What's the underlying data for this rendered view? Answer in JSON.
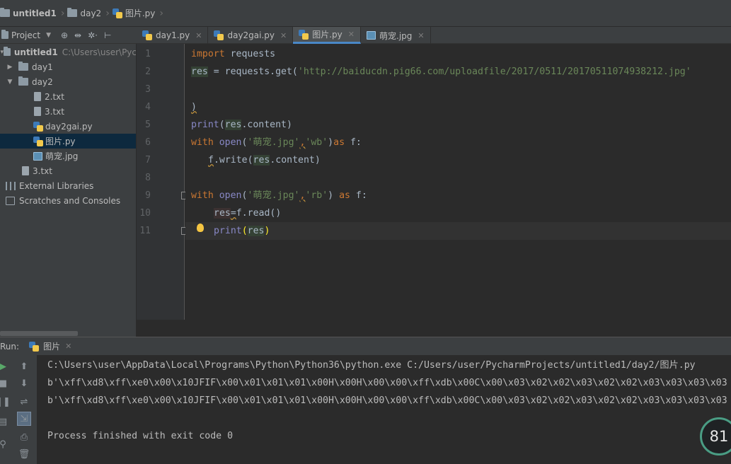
{
  "breadcrumb": {
    "project": "untitled1",
    "folder": "day2",
    "file": "图片.py"
  },
  "project_panel": {
    "title": "Project",
    "tools": [
      "⊕",
      "⇹",
      "✲·",
      "⊢"
    ]
  },
  "tabs": [
    {
      "label": "day1.py",
      "icon": "python-file-icon"
    },
    {
      "label": "day2gai.py",
      "icon": "python-file-icon"
    },
    {
      "label": "图片.py",
      "icon": "python-file-icon",
      "active": true
    },
    {
      "label": "萌宠.jpg",
      "icon": "image-file-icon"
    }
  ],
  "tree": {
    "root": {
      "label": "untitled1",
      "path": "C:\\Users\\user\\Pyc"
    },
    "items": [
      {
        "label": "day1",
        "type": "folder"
      },
      {
        "label": "day2",
        "type": "folder"
      },
      {
        "label": "2.txt",
        "type": "text"
      },
      {
        "label": "3.txt",
        "type": "text"
      },
      {
        "label": "day2gai.py",
        "type": "python"
      },
      {
        "label": "图片.py",
        "type": "python",
        "selected": true
      },
      {
        "label": "萌宠.jpg",
        "type": "image"
      },
      {
        "label": "3.txt",
        "type": "text"
      },
      {
        "label": "External Libraries",
        "type": "libraries"
      },
      {
        "label": "Scratches and Consoles",
        "type": "scratches"
      }
    ]
  },
  "editor": {
    "line_numbers": [
      "1",
      "2",
      "3",
      "4",
      "5",
      "6",
      "7",
      "8",
      "9",
      "10",
      "11"
    ],
    "lines": {
      "l1_kw": "import",
      "l1_rest": " requests",
      "l2_a": "res",
      "l2_b": " = requests.get(",
      "l2_str": "'http://baiducdn.pig66.com/uploadfile/2017/0511/20170511074938212.jpg'",
      "l4": ")",
      "l5_fn": "print",
      "l5_a": "(",
      "l5_res": "res",
      "l5_b": ".content)",
      "l6_kw": "with",
      "l6_sp": " ",
      "l6_fn": "open",
      "l6_a": "(",
      "l6_s1": "'萌宠.jpg'",
      "l6_comma": ",",
      "l6_s2": "'wb'",
      "l6_b": ")",
      "l6_as": "as",
      "l6_c": " f:",
      "l7_f": "f",
      "l7_a": ".write(",
      "l7_res": "res",
      "l7_b": ".content)",
      "l9_kw": "with",
      "l9_sp": " ",
      "l9_fn": "open",
      "l9_a": "(",
      "l9_s1": "'萌宠.jpg'",
      "l9_comma": ",",
      "l9_s2": "'rb'",
      "l9_b": ") ",
      "l9_as": "as",
      "l9_c": " f:",
      "l10_res": "res",
      "l10_eq": "=",
      "l10_b": "f.read()",
      "l11_fn": "print",
      "l11_a": "(",
      "l11_res": "res",
      "l11_b": ")"
    }
  },
  "run": {
    "label": "Run:",
    "tab": "图片",
    "output": [
      "C:\\Users\\user\\AppData\\Local\\Programs\\Python\\Python36\\python.exe C:/Users/user/PycharmProjects/untitled1/day2/图片.py",
      "b'\\xff\\xd8\\xff\\xe0\\x00\\x10JFIF\\x00\\x01\\x01\\x01\\x00H\\x00H\\x00\\x00\\xff\\xdb\\x00C\\x00\\x03\\x02\\x02\\x03\\x02\\x02\\x03\\x03\\x03\\x03",
      "b'\\xff\\xd8\\xff\\xe0\\x00\\x10JFIF\\x00\\x01\\x01\\x01\\x00H\\x00H\\x00\\x00\\xff\\xdb\\x00C\\x00\\x03\\x02\\x02\\x03\\x02\\x02\\x03\\x03\\x03\\x03",
      "",
      "Process finished with exit code 0"
    ]
  },
  "memory_indicator": "81",
  "colors": {
    "keyword": "#cc7832",
    "builtin": "#8888c6",
    "string": "#6a8759",
    "selection": "#0d293e",
    "active_tab_underline": "#4a88c7"
  }
}
